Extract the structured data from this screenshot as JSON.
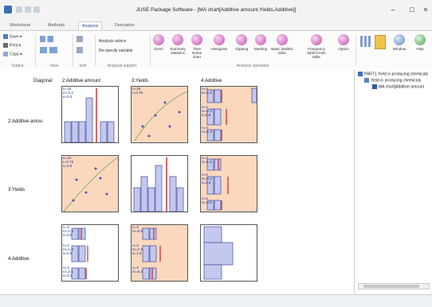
{
  "window": {
    "title": "JUSE Package Software - [MA chart[Additive amount,Yields,Additive]]"
  },
  "tabs": [
    {
      "label": "Worksheet",
      "active": false
    },
    {
      "label": "Methods",
      "active": false
    },
    {
      "label": "Analysis",
      "active": true
    },
    {
      "label": "Derivation",
      "active": false
    }
  ],
  "ribbon": {
    "save": "Save",
    "print": "Print",
    "copy": "Copy",
    "analysis_advice": "Analysis advice",
    "re_specify": "Re-specify variable",
    "groups": {
      "output": "Output",
      "view": "View",
      "sort": "Sort",
      "analysis_support": "Analysis support",
      "analysis_operation": "Analysis operation"
    },
    "operations": [
      {
        "label": "Zoom"
      },
      {
        "label": "Summary statistics"
      },
      {
        "label": "Time series chart"
      },
      {
        "label": "Histogram"
      },
      {
        "label": "Clipping"
      },
      {
        "label": "Marking"
      },
      {
        "label": "Basic statistic table"
      },
      {
        "label": "Frequency table/Cross table"
      },
      {
        "label": "Option"
      }
    ],
    "window": "Window",
    "help": "Help"
  },
  "matrix": {
    "corner_label": "Diagonal",
    "columns": [
      "2:Additive amount",
      "3:Yields",
      "4:Additive"
    ],
    "rows": [
      "2:Additive amou",
      "3:Yields",
      "4:Additive"
    ],
    "stats": {
      "c11": "n=10\nm=2.2\ns=0.4",
      "c12": "n=19\nr=0.76",
      "c13a": "n=3\nm=1.5",
      "c13b": "n=4\nm=2.3\ns=0.9",
      "c13c": "n=3\nm=1.3",
      "c21": "n=10\nr=0.76\ns=0.5",
      "c23a": "n=3\nm=1.5",
      "c23b": "n=4\nm=2.2\ns=3.3",
      "c23c": "n=3\nm=2.5",
      "c31a": "n=3\nm=1.3\ns=0.5",
      "c31b": "n=4\nm=1.8\ns=0.9",
      "c31c": "n=3\nm=2.1\ns=0.3",
      "c32a": "n=3\nm=6.5",
      "c32b": "n=4\nm=7.2\ns=1.5",
      "c32c": "n=3\nm=6.3"
    }
  },
  "tree": {
    "root": "PART1 Yield in producing chemicals",
    "child": "Yield in producing chemicals",
    "leaf": "MA chart[Additive amount"
  }
}
